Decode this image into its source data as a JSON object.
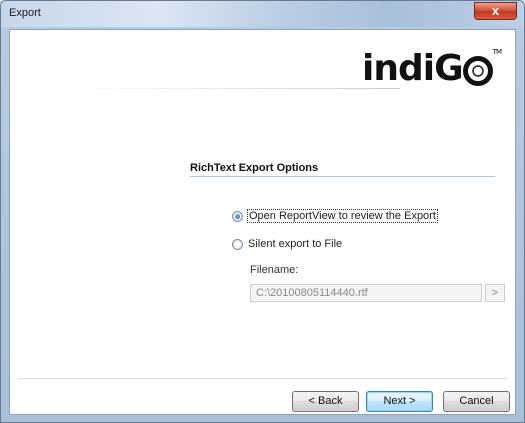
{
  "window": {
    "title": "Export",
    "close_glyph": "x"
  },
  "logo": {
    "text_prefix": "indi",
    "text_suffix": "G",
    "tm": "TM"
  },
  "section": {
    "title": "RichText Export Options"
  },
  "options": [
    {
      "label": "Open ReportView to review the Export",
      "checked": true
    },
    {
      "label": "Silent export to File",
      "checked": false
    }
  ],
  "filename": {
    "label": "Filename:",
    "value": "C:\\20100805114440.rtf",
    "browse_label": ">"
  },
  "buttons": {
    "back": "< Back",
    "next": "Next >",
    "cancel": "Cancel"
  }
}
